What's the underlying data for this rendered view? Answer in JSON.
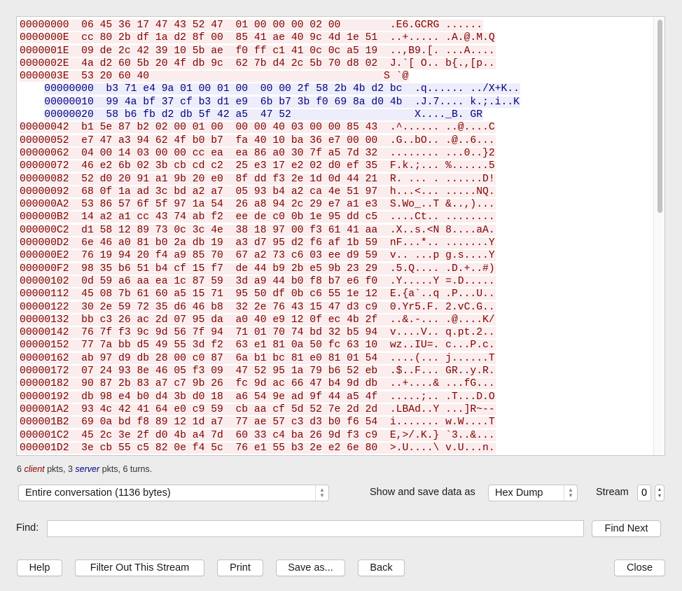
{
  "dump": {
    "lines": [
      {
        "dir": "client",
        "text": "00000000  06 45 36 17 47 43 52 47  01 00 00 00 02 00        .E6.GCRG ......"
      },
      {
        "dir": "client",
        "text": "0000000E  cc 80 2b df 1a d2 8f 00  85 41 ae 40 9c 4d 1e 51  ..+..... .A.@.M.Q"
      },
      {
        "dir": "client",
        "text": "0000001E  09 de 2c 42 39 10 5b ae  f0 ff c1 41 0c 0c a5 19  ..,B9.[. ...A...."
      },
      {
        "dir": "client",
        "text": "0000002E  4a d2 60 5b 20 4f db 9c  62 7b d4 2c 5b 70 d8 02  J.`[ O.. b{.,[p.."
      },
      {
        "dir": "client",
        "text": "0000003E  53 20 60 40                                      S `@"
      },
      {
        "dir": "server",
        "text": "    00000000  b3 71 e4 9a 01 00 01 00  00 00 2f 58 2b 4b d2 bc  .q...... ../X+K.."
      },
      {
        "dir": "server",
        "text": "    00000010  99 4a bf 37 cf b3 d1 e9  6b b7 3b f0 69 8a d0 4b  .J.7.... k.;.i..K"
      },
      {
        "dir": "server",
        "text": "    00000020  58 b6 fb d2 db 5f 42 a5  47 52                    X...._B. GR"
      },
      {
        "dir": "client",
        "text": "00000042  b1 5e 87 b2 02 00 01 00  00 00 40 03 00 00 85 43  .^...... ..@....C"
      },
      {
        "dir": "client",
        "text": "00000052  e7 47 a3 94 62 4f b0 b7  fa 40 10 ba 36 e7 00 00  .G..bO.. .@..6..."
      },
      {
        "dir": "client",
        "text": "00000062  04 00 14 03 00 00 cc ea  ea 86 a0 30 7f a5 7d 32  ........ ...0..}2"
      },
      {
        "dir": "client",
        "text": "00000072  46 e2 6b 02 3b cb cd c2  25 e3 17 e2 02 d0 ef 35  F.k.;... %......5"
      },
      {
        "dir": "client",
        "text": "00000082  52 d0 20 91 a1 9b 20 e0  8f dd f3 2e 1d 0d 44 21  R. ... . ......D!"
      },
      {
        "dir": "client",
        "text": "00000092  68 0f 1a ad 3c bd a2 a7  05 93 b4 a2 ca 4e 51 97  h...<... .....NQ."
      },
      {
        "dir": "client",
        "text": "000000A2  53 86 57 6f 5f 97 1a 54  26 a8 94 2c 29 e7 a1 e3  S.Wo_..T &..,)..."
      },
      {
        "dir": "client",
        "text": "000000B2  14 a2 a1 cc 43 74 ab f2  ee de c0 0b 1e 95 dd c5  ....Ct.. ........"
      },
      {
        "dir": "client",
        "text": "000000C2  d1 58 12 89 73 0c 3c 4e  38 18 97 00 f3 61 41 aa  .X..s.<N 8....aA."
      },
      {
        "dir": "client",
        "text": "000000D2  6e 46 a0 81 b0 2a db 19  a3 d7 95 d2 f6 af 1b 59  nF...*.. .......Y"
      },
      {
        "dir": "client",
        "text": "000000E2  76 19 94 20 f4 a9 85 70  67 a2 73 c6 03 ee d9 59  v.. ...p g.s....Y"
      },
      {
        "dir": "client",
        "text": "000000F2  98 35 b6 51 b4 cf 15 f7  de 44 b9 2b e5 9b 23 29  .5.Q.... .D.+..#)"
      },
      {
        "dir": "client",
        "text": "00000102  0d 59 a6 aa ea 1c 87 59  3d a9 44 b0 f8 b7 e6 f0  .Y.....Y =.D....."
      },
      {
        "dir": "client",
        "text": "00000112  45 08 7b 61 60 a5 15 71  95 50 df 0b c6 55 1e 12  E.{a`..q .P...U.."
      },
      {
        "dir": "client",
        "text": "00000122  30 2e 59 72 35 d6 46 b8  32 2e 76 43 15 47 d3 c9  0.Yr5.F. 2.vC.G.."
      },
      {
        "dir": "client",
        "text": "00000132  bb c3 26 ac 2d 07 95 da  a0 40 e9 12 0f ec 4b 2f  ..&.-... .@....K/"
      },
      {
        "dir": "client",
        "text": "00000142  76 7f f3 9c 9d 56 7f 94  71 01 70 74 bd 32 b5 94  v....V.. q.pt.2.."
      },
      {
        "dir": "client",
        "text": "00000152  77 7a bb d5 49 55 3d f2  63 e1 81 0a 50 fc 63 10  wz..IU=. c...P.c."
      },
      {
        "dir": "client",
        "text": "00000162  ab 97 d9 db 28 00 c0 87  6a b1 bc 81 e0 81 01 54  ....(... j......T"
      },
      {
        "dir": "client",
        "text": "00000172  07 24 93 8e 46 05 f3 09  47 52 95 1a 79 b6 52 eb  .$..F... GR..y.R."
      },
      {
        "dir": "client",
        "text": "00000182  90 87 2b 83 a7 c7 9b 26  fc 9d ac 66 47 b4 9d db  ..+....& ...fG..."
      },
      {
        "dir": "client",
        "text": "00000192  db 98 e4 b0 d4 3b d0 18  a6 54 9e ad 9f 44 a5 4f  .....;.. .T...D.O"
      },
      {
        "dir": "client",
        "text": "000001A2  93 4c 42 41 64 e0 c9 59  cb aa cf 5d 52 7e 2d 2d  .LBAd..Y ...]R~--"
      },
      {
        "dir": "client",
        "text": "000001B2  69 0a bd f8 89 12 1d a7  77 ae 57 c3 d3 b0 f6 54  i....... w.W....T"
      },
      {
        "dir": "client",
        "text": "000001C2  45 2c 3e 2f d0 4b a4 7d  60 33 c4 ba 26 9d f3 c9  E,>/.K.} `3..&..."
      },
      {
        "dir": "client",
        "text": "000001D2  3e cb 55 c5 82 0e f4 5c  76 e1 55 b3 2e e2 6e 80  >.U....\\ v.U...n."
      }
    ]
  },
  "stats": {
    "client_count": "6",
    "client_word": "client",
    "mid": " pkts, 3 ",
    "server_word": "server",
    "tail": " pkts, 6 turns."
  },
  "conversation_select": {
    "value": "Entire conversation (1136 bytes)"
  },
  "show_as": {
    "label": "Show and save data as",
    "value": "Hex Dump"
  },
  "stream": {
    "label": "Stream",
    "value": "0"
  },
  "find": {
    "label": "Find:",
    "value": "",
    "button": "Find Next"
  },
  "buttons": {
    "help": "Help",
    "filter_out": "Filter Out This Stream",
    "print": "Print",
    "save_as": "Save as...",
    "back": "Back",
    "close": "Close"
  },
  "colors": {
    "client_fg": "#7f0000",
    "client_bg": "#fbeded",
    "server_fg": "#00007f",
    "server_bg": "#ededfb"
  }
}
